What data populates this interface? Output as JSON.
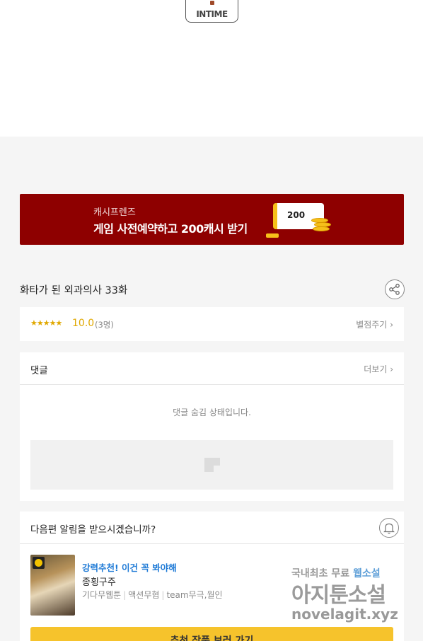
{
  "logo": {
    "text": "INTIME"
  },
  "banner": {
    "subtitle": "캐시프렌즈",
    "title": "게임 사전예약하고 200캐시 받기",
    "ticket_value": "200",
    "colors": {
      "background": "#8e0000",
      "coin": "#f6c01a"
    }
  },
  "episode": {
    "title": "화타가 된 외과의사 33화",
    "share_icon": "share-icon"
  },
  "rating": {
    "stars": "★★★★★",
    "score": "10.0",
    "count": "(3명)",
    "rate_link": "별점주기",
    "chevron": "›"
  },
  "comments": {
    "title": "댓글",
    "more": "더보기",
    "chevron": "›",
    "hidden_message": "댓글 숨김 상태입니다."
  },
  "notify": {
    "question": "다음편 알림을 받으시겠습니까?",
    "bell_icon": "bell-icon"
  },
  "recommend": {
    "tag": "강력추천! 이건 꼭 봐야해",
    "title": "종횡구주",
    "meta": [
      "기다무웹툰",
      "액션무협",
      "team무극,월인"
    ],
    "cta": "추천 작품 보러 가기",
    "colors": {
      "tag": "#1e7ad6",
      "cta": "#f6c32c"
    }
  },
  "watermark": {
    "line1_a": "국내최초 무료 ",
    "line1_b": "웹소설",
    "line2": "아지툰소설",
    "line3": "novelagit.xyz"
  }
}
